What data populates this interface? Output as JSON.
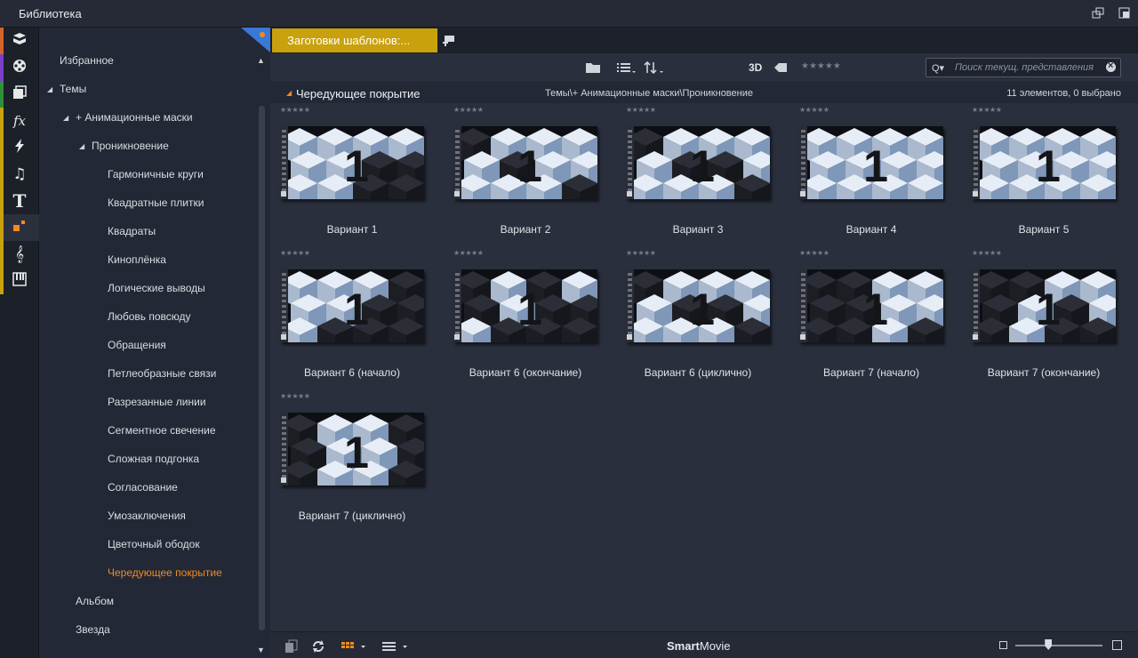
{
  "window": {
    "title": "Библиотека"
  },
  "rail": {
    "items": [
      {
        "name": "projects",
        "icon": "box-stack-icon",
        "stripe": "#d4632a"
      },
      {
        "name": "media",
        "icon": "film-reel-icon",
        "stripe": "#7a3ec9"
      },
      {
        "name": "collections",
        "icon": "photo-stack-icon",
        "stripe": "#2f8f3a"
      },
      {
        "name": "effects",
        "icon": "fx-icon",
        "stripe": "#c9a10c",
        "glyph": "fx"
      },
      {
        "name": "transitions",
        "icon": "lightning-icon",
        "stripe": "#c9a10c"
      },
      {
        "name": "music",
        "icon": "music-note-icon",
        "stripe": "#c9a10c",
        "glyph": "♫"
      },
      {
        "name": "titles",
        "icon": "title-t-icon",
        "stripe": "#c9a10c",
        "glyph": "T"
      },
      {
        "name": "montage",
        "icon": "montage-squares-icon",
        "stripe": "#c9a10c"
      },
      {
        "name": "soundtrack",
        "icon": "treble-clef-icon",
        "stripe": "#c9a10c",
        "glyph": "𝄞"
      },
      {
        "name": "scorefitter",
        "icon": "piano-keys-icon",
        "stripe": "#c9a10c"
      }
    ]
  },
  "tree": {
    "items": [
      {
        "label": "Избранное",
        "level": 0,
        "arrow": ""
      },
      {
        "label": "Темы",
        "level": 0,
        "arrow": "▲"
      },
      {
        "label": "+ Анимационные маски",
        "level": 1,
        "arrow": "▲"
      },
      {
        "label": "Проникновение",
        "level": 2,
        "arrow": "▲"
      },
      {
        "label": "Гармоничные круги",
        "level": 3,
        "arrow": ""
      },
      {
        "label": "Квадратные плитки",
        "level": 3,
        "arrow": ""
      },
      {
        "label": "Квадраты",
        "level": 3,
        "arrow": ""
      },
      {
        "label": "Киноплёнка",
        "level": 3,
        "arrow": ""
      },
      {
        "label": "Логические выводы",
        "level": 3,
        "arrow": ""
      },
      {
        "label": "Любовь повсюду",
        "level": 3,
        "arrow": ""
      },
      {
        "label": "Обращения",
        "level": 3,
        "arrow": ""
      },
      {
        "label": "Петлеобразные связи",
        "level": 3,
        "arrow": ""
      },
      {
        "label": "Разрезанные линии",
        "level": 3,
        "arrow": ""
      },
      {
        "label": "Сегментное свечение",
        "level": 3,
        "arrow": ""
      },
      {
        "label": "Сложная подгонка",
        "level": 3,
        "arrow": ""
      },
      {
        "label": "Согласование",
        "level": 3,
        "arrow": ""
      },
      {
        "label": "Умозаключения",
        "level": 3,
        "arrow": ""
      },
      {
        "label": "Цветочный ободок",
        "level": 3,
        "arrow": ""
      },
      {
        "label": "Чередующее покрытие",
        "level": 3,
        "arrow": "",
        "selected": true
      },
      {
        "label": "Альбом",
        "level": 1,
        "arrow": ""
      },
      {
        "label": "Звезда",
        "level": 1,
        "arrow": ""
      }
    ]
  },
  "tab": {
    "label": "Заготовки шаблонов:..."
  },
  "toolbar": {
    "three_d": "3D",
    "stars": "★★★★★",
    "search_placeholder": "Поиск текущ. представления",
    "search_q": "Q▾"
  },
  "header": {
    "arrow": "◢",
    "title": "Чередующее покрытие",
    "path": "Темы\\+ Анимационные маски\\Проникновение",
    "count": "11 элементов, 0 выбрано"
  },
  "items": [
    {
      "label": "Вариант 1",
      "stars": "★★★★★",
      "pattern": 0
    },
    {
      "label": "Вариант 2",
      "stars": "★★★★★",
      "pattern": 1
    },
    {
      "label": "Вариант 3",
      "stars": "★★★★★",
      "pattern": 2
    },
    {
      "label": "Вариант 4",
      "stars": "★★★★★",
      "pattern": 3
    },
    {
      "label": "Вариант 5",
      "stars": "★★★★★",
      "pattern": 3
    },
    {
      "label": "Вариант 6 (начало)",
      "stars": "★★★★★",
      "pattern": 4
    },
    {
      "label": "Вариант 6 (окончание)",
      "stars": "★★★★★",
      "pattern": 5
    },
    {
      "label": "Вариант 6 (циклично)",
      "stars": "★★★★★",
      "pattern": 2
    },
    {
      "label": "Вариант 7 (начало)",
      "stars": "★★★★★",
      "pattern": 6
    },
    {
      "label": "Вариант 7 (окончание)",
      "stars": "★★★★★",
      "pattern": 7
    },
    {
      "label": "Вариант 7 (циклично)",
      "stars": "★★★★★",
      "pattern": 8
    }
  ],
  "thumb_numeral": "1",
  "status": {
    "brand_bold": "Smart",
    "brand_rest": "Movie",
    "zoom_level": 0.38
  },
  "colors": {
    "accent": "#c9a10c",
    "selected": "#f28a1e",
    "corner": "#3a78d6"
  }
}
